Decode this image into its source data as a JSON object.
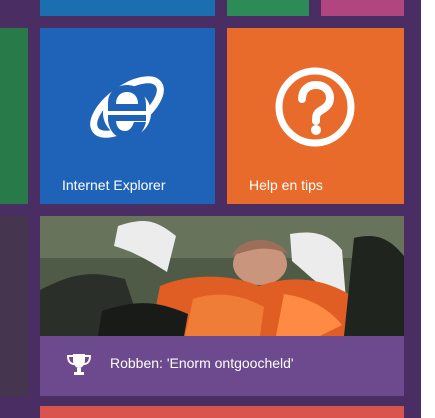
{
  "tiles": {
    "internet_explorer": {
      "label": "Internet Explorer",
      "icon": "internet-explorer-icon",
      "color": "#1f63b8"
    },
    "help": {
      "label": "Help en tips",
      "icon": "help-question-icon",
      "color": "#e96b2c"
    },
    "news": {
      "caption": "Robben: 'Enorm ontgoocheld'",
      "icon": "trophy-icon",
      "caption_color": "#6c4a8d"
    }
  },
  "background": {
    "color": "#4a2d63"
  }
}
